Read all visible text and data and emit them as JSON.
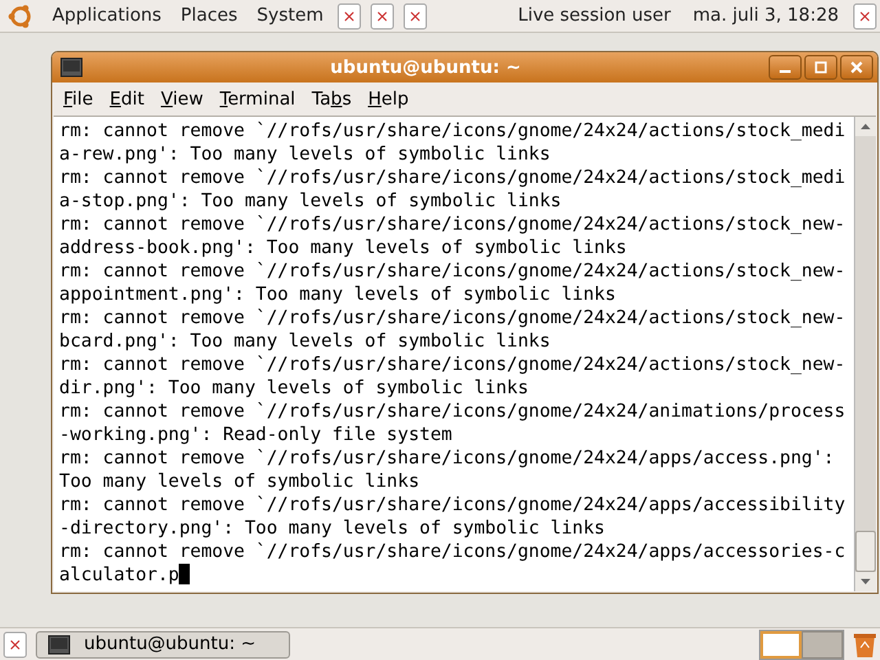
{
  "top_panel": {
    "menus": [
      {
        "label": "Applications"
      },
      {
        "label": "Places"
      },
      {
        "label": "System"
      }
    ],
    "user": "Live session user",
    "clock": "ma. juli  3, 18:28"
  },
  "window": {
    "title": "ubuntu@ubuntu: ~",
    "menu": [
      {
        "key": "F",
        "after": "ile"
      },
      {
        "key": "E",
        "after": "dit"
      },
      {
        "key": "V",
        "after": "iew"
      },
      {
        "key": "T",
        "after": "erminal"
      },
      {
        "before": "Ta",
        "key": "b",
        "after": "s"
      },
      {
        "key": "H",
        "after": "elp"
      }
    ],
    "lines": [
      "rm: cannot remove `//rofs/usr/share/icons/gnome/24x24/actions/stock_medi",
      "a-rew.png': Too many levels of symbolic links",
      "rm: cannot remove `//rofs/usr/share/icons/gnome/24x24/actions/stock_medi",
      "a-stop.png': Too many levels of symbolic links",
      "rm: cannot remove `//rofs/usr/share/icons/gnome/24x24/actions/stock_new-",
      "address-book.png': Too many levels of symbolic links",
      "rm: cannot remove `//rofs/usr/share/icons/gnome/24x24/actions/stock_new-",
      "appointment.png': Too many levels of symbolic links",
      "rm: cannot remove `//rofs/usr/share/icons/gnome/24x24/actions/stock_new-",
      "bcard.png': Too many levels of symbolic links",
      "rm: cannot remove `//rofs/usr/share/icons/gnome/24x24/actions/stock_new-",
      "dir.png': Too many levels of symbolic links",
      "rm: cannot remove `//rofs/usr/share/icons/gnome/24x24/animations/process",
      "-working.png': Read-only file system",
      "rm: cannot remove `//rofs/usr/share/icons/gnome/24x24/apps/access.png':",
      "Too many levels of symbolic links",
      "rm: cannot remove `//rofs/usr/share/icons/gnome/24x24/apps/accessibility",
      "-directory.png': Too many levels of symbolic links",
      "rm: cannot remove `//rofs/usr/share/icons/gnome/24x24/apps/accessories-c",
      "alculator.p"
    ]
  },
  "bottom_panel": {
    "task": {
      "label": "ubuntu@ubuntu: ~",
      "selected": false
    },
    "workspaces": [
      {
        "selected": true
      },
      {
        "selected": false
      }
    ]
  }
}
